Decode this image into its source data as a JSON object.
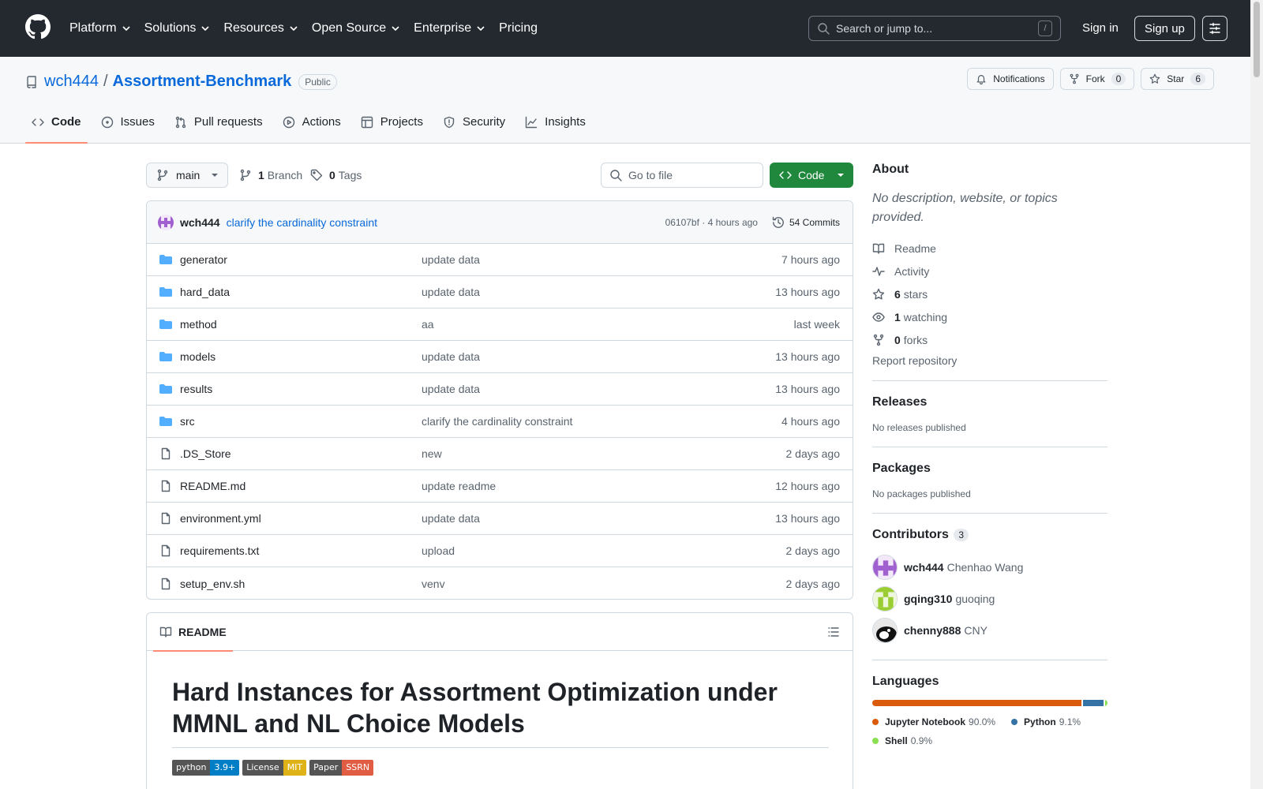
{
  "header": {
    "nav": [
      "Platform",
      "Solutions",
      "Resources",
      "Open Source",
      "Enterprise",
      "Pricing"
    ],
    "search_placeholder": "Search or jump to...",
    "search_key": "/",
    "sign_in": "Sign in",
    "sign_up": "Sign up"
  },
  "repo": {
    "owner": "wch444",
    "separator": "/",
    "name": "Assortment-Benchmark",
    "visibility": "Public",
    "notifications": "Notifications",
    "fork_label": "Fork",
    "fork_count": "0",
    "star_label": "Star",
    "star_count": "6",
    "tabs": [
      "Code",
      "Issues",
      "Pull requests",
      "Actions",
      "Projects",
      "Security",
      "Insights"
    ]
  },
  "toolbar": {
    "branch": "main",
    "branch_count": "1",
    "branch_label": "Branch",
    "tag_count": "0",
    "tag_label": "Tags",
    "goto_placeholder": "Go to file",
    "code_button": "Code"
  },
  "commit": {
    "author": "wch444",
    "message": "clarify the cardinality constraint",
    "meta": "06107bf · 4 hours ago",
    "commits": "54 Commits"
  },
  "files": [
    {
      "type": "dir",
      "name": "generator",
      "message": "update data",
      "date": "7 hours ago"
    },
    {
      "type": "dir",
      "name": "hard_data",
      "message": "update data",
      "date": "13 hours ago"
    },
    {
      "type": "dir",
      "name": "method",
      "message": "aa",
      "date": "last week"
    },
    {
      "type": "dir",
      "name": "models",
      "message": "update data",
      "date": "13 hours ago"
    },
    {
      "type": "dir",
      "name": "results",
      "message": "update data",
      "date": "13 hours ago"
    },
    {
      "type": "dir",
      "name": "src",
      "message": "clarify the cardinality constraint",
      "date": "4 hours ago"
    },
    {
      "type": "file",
      "name": ".DS_Store",
      "message": "new",
      "date": "2 days ago"
    },
    {
      "type": "file",
      "name": "README.md",
      "message": "update readme",
      "date": "12 hours ago"
    },
    {
      "type": "file",
      "name": "environment.yml",
      "message": "update data",
      "date": "13 hours ago"
    },
    {
      "type": "file",
      "name": "requirements.txt",
      "message": "upload",
      "date": "2 days ago"
    },
    {
      "type": "file",
      "name": "setup_env.sh",
      "message": "venv",
      "date": "2 days ago"
    }
  ],
  "readme": {
    "tab": "README",
    "title": "Hard Instances for Assortment Optimization under MMNL and NL Choice Models",
    "shields": [
      {
        "label": "python",
        "value": "3.9+",
        "color": "#007ec6"
      },
      {
        "label": "License",
        "value": "MIT",
        "color": "#dfb317"
      },
      {
        "label": "Paper",
        "value": "SSRN",
        "color": "#e05d44"
      }
    ]
  },
  "sidebar": {
    "about_title": "About",
    "about_desc": "No description, website, or topics provided.",
    "readme": "Readme",
    "activity": "Activity",
    "stars_count": "6",
    "stars_label": "stars",
    "watching_count": "1",
    "watching_label": "watching",
    "forks_count": "0",
    "forks_label": "forks",
    "report": "Report repository",
    "releases_title": "Releases",
    "releases_note": "No releases published",
    "packages_title": "Packages",
    "packages_note": "No packages published",
    "contributors_title": "Contributors",
    "contributors_count": "3",
    "contributors": [
      {
        "login": "wch444",
        "name": "Chenhao Wang"
      },
      {
        "login": "gqing310",
        "name": "guoqing"
      },
      {
        "login": "chenny888",
        "name": "CNY"
      }
    ],
    "languages_title": "Languages",
    "languages": [
      {
        "name": "Jupyter Notebook",
        "pct": "90.0%",
        "value": 90.0,
        "color": "#DA5B0B"
      },
      {
        "name": "Python",
        "pct": "9.1%",
        "value": 9.1,
        "color": "#3572A5"
      },
      {
        "name": "Shell",
        "pct": "0.9%",
        "value": 0.9,
        "color": "#89e051"
      }
    ]
  }
}
